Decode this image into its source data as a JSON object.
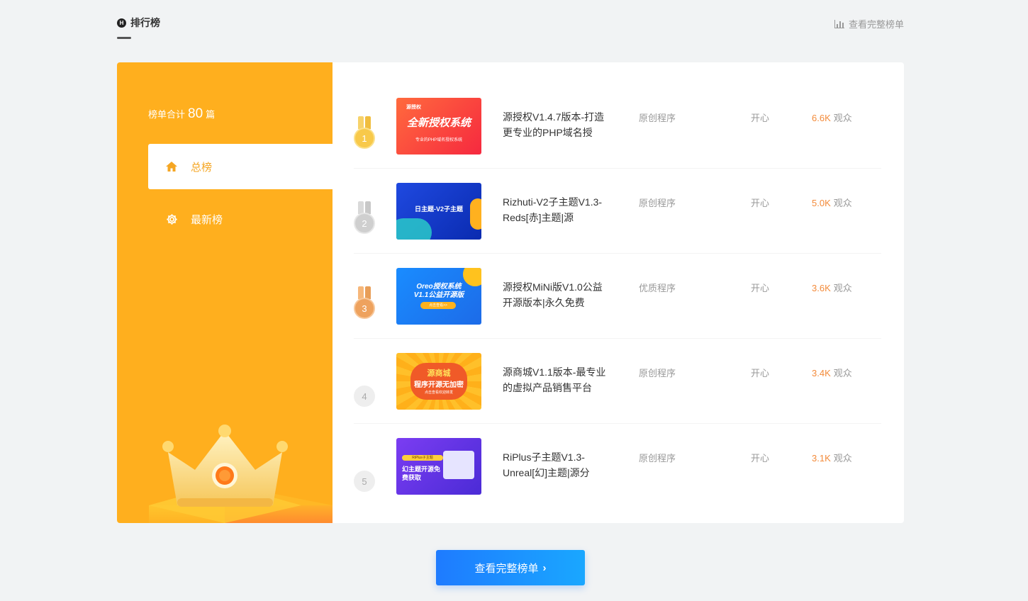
{
  "header": {
    "title": "排行榜",
    "title_icon": "h-icon",
    "more_label": "查看完整榜单"
  },
  "sidebar": {
    "total_prefix": "榜单合计",
    "total_count": "80",
    "total_suffix": "篇",
    "tabs": [
      {
        "label": "总榜",
        "icon": "home-icon",
        "active": true
      },
      {
        "label": "最新榜",
        "icon": "gear-icon",
        "active": false
      }
    ]
  },
  "items": [
    {
      "rank": "1",
      "title": "源授权V1.4.7版本-打造更专业的PHP域名授",
      "category": "原创程序",
      "author": "开心",
      "views": "6.6K",
      "views_label": "观众",
      "thumb_text": "全新授权系统",
      "thumb_sub": "专业的PHP域名授权系统",
      "thumb_top": "源授权",
      "medal": "gold"
    },
    {
      "rank": "2",
      "title": "Rizhuti-V2子主题V1.3-Reds[赤]主题|源",
      "category": "原创程序",
      "author": "开心",
      "views": "5.0K",
      "views_label": "观众",
      "thumb_text": "日主题-V2子主题",
      "thumb_sub": "",
      "medal": "silver"
    },
    {
      "rank": "3",
      "title": "源授权MiNi版V1.0公益开源版本|永久免费",
      "category": "优质程序",
      "author": "开心",
      "views": "3.6K",
      "views_label": "观众",
      "thumb_text": "Oreo授权系统",
      "thumb_text2": "V1.1公益开源版",
      "thumb_btn": "点击查看>>",
      "medal": "bronze"
    },
    {
      "rank": "4",
      "title": "源商城V1.1版本-最专业的虚拟产品销售平台",
      "category": "原创程序",
      "author": "开心",
      "views": "3.4K",
      "views_label": "观众",
      "thumb_text": "源商城",
      "thumb_text2": "程序开源无加密",
      "thumb_btn": "点击查看欢迎转发",
      "medal": "none"
    },
    {
      "rank": "5",
      "title": "RiPlus子主题V1.3-Unreal[幻]主题|源分",
      "category": "原创程序",
      "author": "开心",
      "views": "3.1K",
      "views_label": "观众",
      "thumb_top": "RiPlus子主题",
      "thumb_text": "幻主题开源免",
      "thumb_text2": "费获取",
      "medal": "none"
    }
  ],
  "footer": {
    "button_label": "查看完整榜单"
  },
  "colors": {
    "accent_orange": "#ffaf1e",
    "views_orange": "#f38b3b",
    "button_blue": "#1e7bff"
  }
}
